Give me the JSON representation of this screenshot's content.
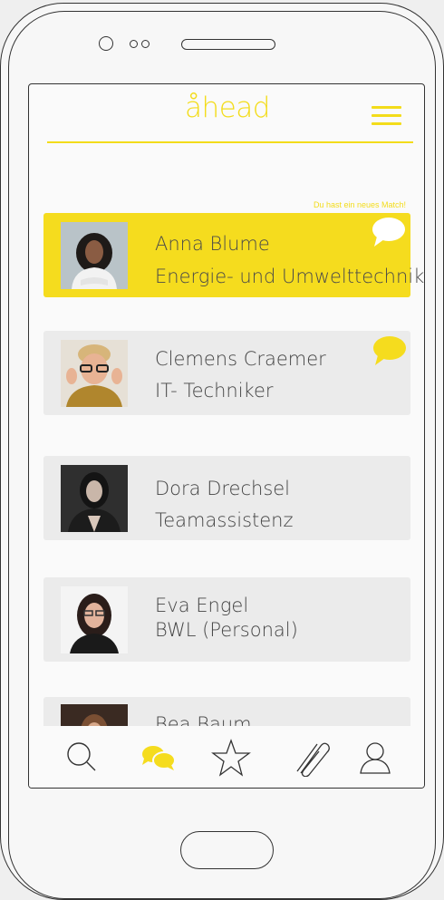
{
  "app": {
    "logo_text": "åhead",
    "brand_color": "#f3dc1a"
  },
  "notice": "Du hast ein neues Match!",
  "matches": [
    {
      "name": "Anna Blume",
      "role": "Energie- und Umwelttechnik",
      "highlighted": true,
      "has_message": true,
      "message_icon": "speech-bubble-icon"
    },
    {
      "name": "Clemens Craemer",
      "role": "IT- Techniker",
      "highlighted": false,
      "has_message": true,
      "message_icon": "speech-bubble-icon"
    },
    {
      "name": "Dora Drechsel",
      "role": "Teamassistenz",
      "highlighted": false,
      "has_message": false
    },
    {
      "name": "Eva Engel",
      "role": "BWL (Personal)",
      "highlighted": false,
      "has_message": false
    },
    {
      "name": "Bea Baum",
      "role": "",
      "highlighted": false,
      "has_message": false
    }
  ],
  "tabbar": {
    "items": [
      {
        "icon": "search-icon",
        "active": false
      },
      {
        "icon": "chat-icon",
        "active": true
      },
      {
        "icon": "star-icon",
        "active": false
      },
      {
        "icon": "paperclip-icon",
        "active": false
      },
      {
        "icon": "profile-icon",
        "active": false
      }
    ]
  }
}
